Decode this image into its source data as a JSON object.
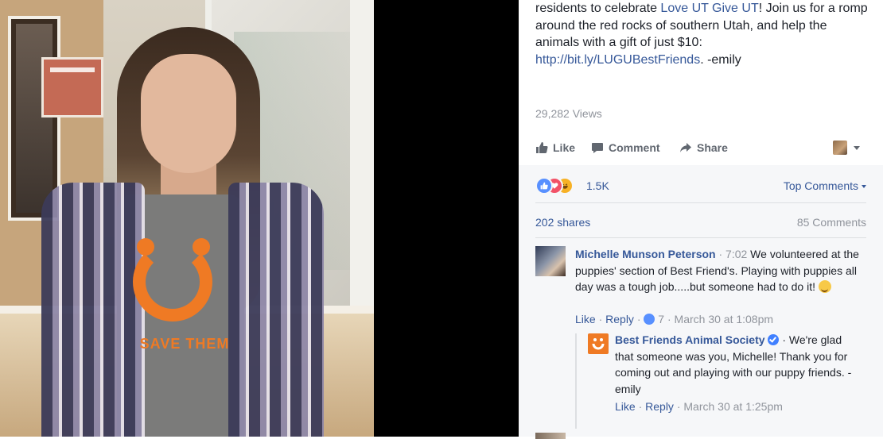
{
  "post": {
    "caption_part1": "residents to celebrate ",
    "caption_link1": "Love UT Give UT",
    "caption_part2": "! Join us for a romp around the red rocks of southern Utah, and help the animals with a gift of just $10: ",
    "caption_link2": "http://bit.ly/LUGUBestFriends",
    "caption_part3": ". -emily",
    "views": "29,282 Views"
  },
  "video": {
    "shirt_text": "SAVE THEM"
  },
  "actions": {
    "like": "Like",
    "comment": "Comment",
    "share": "Share"
  },
  "summary": {
    "reaction_count": "1.5K",
    "sort_label": "Top Comments",
    "shares": "202 shares",
    "comments": "85 Comments"
  },
  "comment": {
    "author": "Michelle Munson Peterson",
    "dot": " · ",
    "time_inline": "7:02",
    "text": " We volunteered at the puppies' section of Best Friend's. Playing with puppies all day was a tough job.....but someone had to do it! ",
    "like_link": "Like",
    "reply_link": "Reply",
    "like_count": "7",
    "timestamp": "March 30 at 1:08pm"
  },
  "reply": {
    "author": "Best Friends Animal Society",
    "text": " · We're glad that someone was you, Michelle! Thank you for coming out and playing with our puppy friends. -emily",
    "like_link": "Like",
    "reply_link": "Reply",
    "timestamp": "March 30 at 1:25pm"
  },
  "icons": [
    "thumbs-up-icon",
    "speech-bubble-icon",
    "share-arrow-icon",
    "chevron-down-icon",
    "like-reaction-icon",
    "love-reaction-icon",
    "haha-reaction-icon",
    "verified-badge-icon",
    "smiley-emoji-icon"
  ],
  "colors": {
    "link": "#365899",
    "muted": "#90949c",
    "accent_orange": "#ef7a24",
    "like_blue": "#5890ff",
    "love_red": "#f25268",
    "haha_yellow": "#f7b125"
  }
}
